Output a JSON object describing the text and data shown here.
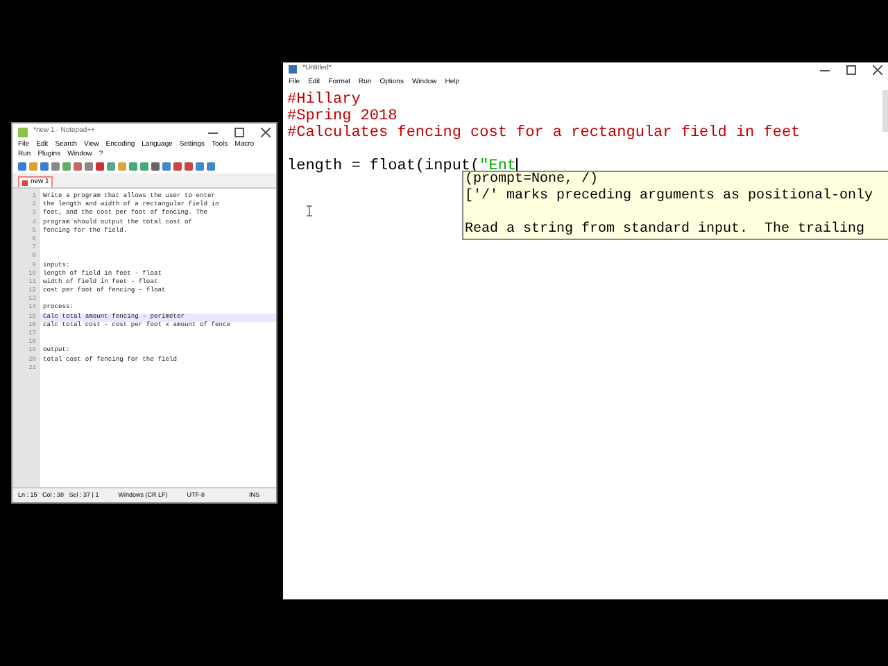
{
  "notepad": {
    "title": "*new 1 - Notepad++",
    "menu": [
      "File",
      "Edit",
      "Search",
      "View",
      "Encoding",
      "Language",
      "Settings",
      "Tools",
      "Macro",
      "Run",
      "Plugins",
      "Window",
      "?"
    ],
    "tabs": [
      {
        "label": "new 1",
        "selected": true
      }
    ],
    "lines": [
      {
        "number": "1",
        "text": "Write a program that allows the user to enter",
        "current": false
      },
      {
        "number": "2",
        "text": "the length and width of a rectangular field in",
        "current": false
      },
      {
        "number": "3",
        "text": "feet, and the cost per foot of fencing. The",
        "current": false
      },
      {
        "number": "4",
        "text": "program should output the total cost of",
        "current": false
      },
      {
        "number": "5",
        "text": "fencing for the field.",
        "current": false
      },
      {
        "number": "6",
        "current": false
      },
      {
        "number": "7",
        "current": false
      },
      {
        "number": "8",
        "current": false
      },
      {
        "number": "9",
        "text": "inputs:",
        "current": false
      },
      {
        "number": "10",
        "text": "length of field in feet - float",
        "current": false
      },
      {
        "number": "11",
        "text": "width of field in feet - float",
        "current": false
      },
      {
        "number": "12",
        "text": "cost per foot of fencing - float",
        "current": false
      },
      {
        "number": "13",
        "current": false
      },
      {
        "number": "14",
        "text": "process:",
        "current": false
      },
      {
        "number": "15",
        "text": "Calc total amount fencing - perimeter",
        "current": true
      },
      {
        "number": "16",
        "text": "calc total cost - cost per foot x amount of fence",
        "current": false
      },
      {
        "number": "17",
        "current": false
      },
      {
        "number": "18",
        "current": false
      },
      {
        "number": "19",
        "text": "output:",
        "current": false
      },
      {
        "number": "20",
        "text": "total cost of fencing for the field",
        "current": false
      },
      {
        "number": "21",
        "current": false
      }
    ],
    "status": [
      "Ln : 15   Col : 38   Sel : 37 | 1",
      "Windows (CR LF)",
      "UTF-8",
      "INS"
    ]
  },
  "idle": {
    "title": "*Untitled*",
    "menu": [
      "File",
      "Edit",
      "Format",
      "Run",
      "Options",
      "Window",
      "Help"
    ],
    "comments": [
      [
        {
          "kind": "comment",
          "text": "#Hillary"
        }
      ],
      [
        {
          "kind": "comment",
          "text": "#Spring 2018"
        }
      ],
      [
        {
          "kind": "comment",
          "text": "#Calculates fencing cost for a rectangular field in feet"
        }
      ]
    ],
    "statement": [
      {
        "kind": "code",
        "text": "length = float(input("
      },
      {
        "kind": "string",
        "text": "\"Ent"
      }
    ],
    "calltip": {
      "signature": [
        "(prompt=None, /)",
        "['/' marks preceding arguments as positional-only"
      ],
      "description": [
        "Read a string from standard input.  The trailing"
      ]
    }
  }
}
